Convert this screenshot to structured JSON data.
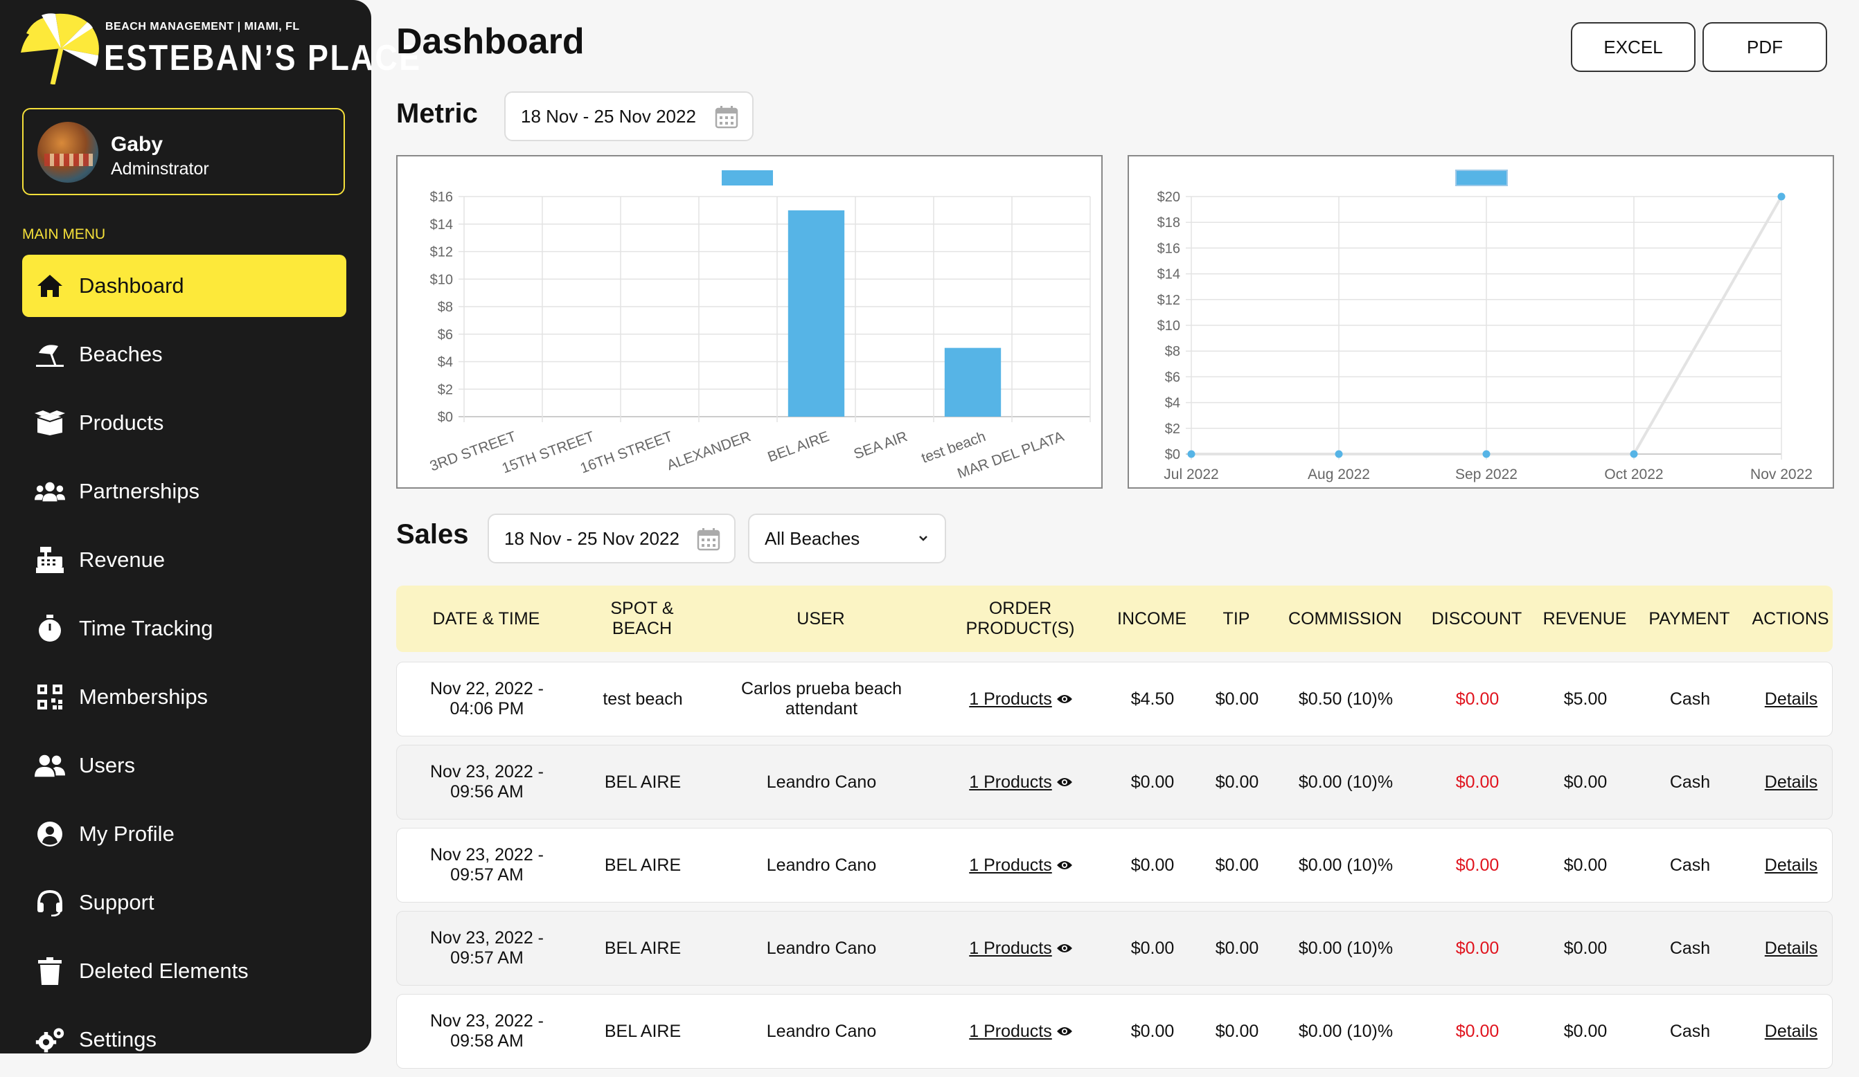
{
  "brand": {
    "subtitle": "BEACH MANAGEMENT | MIAMI, FL",
    "name": "ESTEBAN’S PLACE"
  },
  "user": {
    "name": "Gaby",
    "role": "Adminstrator"
  },
  "sidebar": {
    "caption": "MAIN MENU",
    "items": [
      {
        "label": "Dashboard",
        "icon": "home-icon",
        "active": true
      },
      {
        "label": "Beaches",
        "icon": "beach-umbrella-icon"
      },
      {
        "label": "Products",
        "icon": "box-icon"
      },
      {
        "label": "Partnerships",
        "icon": "users-group-icon"
      },
      {
        "label": "Revenue",
        "icon": "cash-register-icon"
      },
      {
        "label": "Time Tracking",
        "icon": "stopwatch-icon"
      },
      {
        "label": "Memberships",
        "icon": "qr-code-icon"
      },
      {
        "label": "Users",
        "icon": "user-friends-icon"
      },
      {
        "label": "My Profile",
        "icon": "user-circle-icon"
      },
      {
        "label": "Support",
        "icon": "headset-icon"
      },
      {
        "label": "Deleted Elements",
        "icon": "trash-icon"
      },
      {
        "label": "Settings",
        "icon": "gears-icon"
      }
    ]
  },
  "header": {
    "title": "Dashboard",
    "excel_label": "EXCEL",
    "pdf_label": "PDF"
  },
  "metric": {
    "title": "Metric",
    "date_range": "18 Nov - 25 Nov 2022"
  },
  "chart_data": [
    {
      "type": "bar",
      "categories": [
        "3RD STREET",
        "15TH STREET",
        "16TH STREET",
        "ALEXANDER",
        "BEL AIRE",
        "SEA AIR",
        "test beach",
        "MAR DEL PLATA"
      ],
      "values": [
        0,
        0,
        0,
        0,
        15,
        0,
        5,
        0
      ],
      "ylim": [
        0,
        16
      ],
      "yticks": [
        "$0",
        "$2",
        "$4",
        "$6",
        "$8",
        "$10",
        "$12",
        "$14",
        "$16"
      ],
      "grid": true,
      "legend": "top-center",
      "color": "#56b4e6"
    },
    {
      "type": "line",
      "categories": [
        "Jul 2022",
        "Aug 2022",
        "Sep 2022",
        "Oct 2022",
        "Nov 2022"
      ],
      "values": [
        0,
        0,
        0,
        0,
        20
      ],
      "ylim": [
        0,
        20
      ],
      "yticks": [
        "$0",
        "$2",
        "$4",
        "$6",
        "$8",
        "$10",
        "$12",
        "$14",
        "$16",
        "$18",
        "$20"
      ],
      "grid": true,
      "legend": "top-center",
      "color": "#56b4e6",
      "line_color": "#e3e3e3"
    }
  ],
  "sales": {
    "title": "Sales",
    "date_range": "18 Nov - 25 Nov 2022",
    "beach_filter": "All Beaches",
    "columns": [
      "DATE & TIME",
      "SPOT &\nBEACH",
      "USER",
      "ORDER\nPRODUCT(S)",
      "INCOME",
      "TIP",
      "COMMISSION",
      "DISCOUNT",
      "REVENUE",
      "PAYMENT",
      "ACTIONS"
    ],
    "rows": [
      {
        "date": "Nov 22, 2022 -",
        "time": "04:06 PM",
        "spot": "test beach",
        "user": "Carlos prueba beach attendant",
        "products": "1 Products",
        "income": "$4.50",
        "tip": "$0.00",
        "commission": "$0.50 (10)%",
        "discount": "$0.00",
        "revenue": "$5.00",
        "payment": "Cash",
        "action": "Details"
      },
      {
        "date": "Nov 23, 2022 -",
        "time": "09:56 AM",
        "spot": "BEL AIRE",
        "user": "Leandro Cano",
        "products": "1 Products",
        "income": "$0.00",
        "tip": "$0.00",
        "commission": "$0.00 (10)%",
        "discount": "$0.00",
        "revenue": "$0.00",
        "payment": "Cash",
        "action": "Details"
      },
      {
        "date": "Nov 23, 2022 -",
        "time": "09:57 AM",
        "spot": "BEL AIRE",
        "user": "Leandro Cano",
        "products": "1 Products",
        "income": "$0.00",
        "tip": "$0.00",
        "commission": "$0.00 (10)%",
        "discount": "$0.00",
        "revenue": "$0.00",
        "payment": "Cash",
        "action": "Details"
      },
      {
        "date": "Nov 23, 2022 -",
        "time": "09:57 AM",
        "spot": "BEL AIRE",
        "user": "Leandro Cano",
        "products": "1 Products",
        "income": "$0.00",
        "tip": "$0.00",
        "commission": "$0.00 (10)%",
        "discount": "$0.00",
        "revenue": "$0.00",
        "payment": "Cash",
        "action": "Details"
      },
      {
        "date": "Nov 23, 2022 -",
        "time": "09:58 AM",
        "spot": "BEL AIRE",
        "user": "Leandro Cano",
        "products": "1 Products",
        "income": "$0.00",
        "tip": "$0.00",
        "commission": "$0.00 (10)%",
        "discount": "$0.00",
        "revenue": "$0.00",
        "payment": "Cash",
        "action": "Details"
      }
    ]
  },
  "colors": {
    "sidebar_bg": "#1b1b1b",
    "accent_yellow": "#fde93a",
    "table_header_bg": "#fbf4c4",
    "discount_red": "#e0141e",
    "chart_blue": "#56b4e6"
  }
}
